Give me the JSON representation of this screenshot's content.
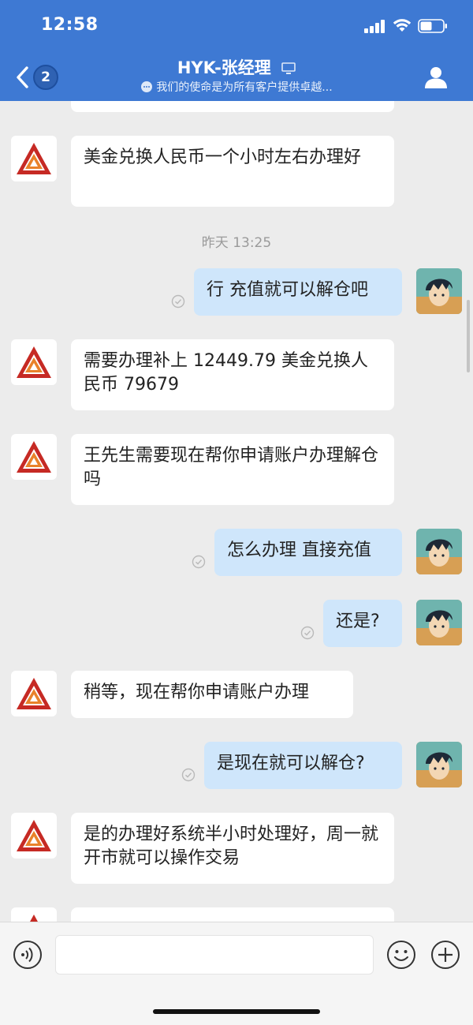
{
  "status_bar": {
    "time": "12:58"
  },
  "header": {
    "back_badge": "2",
    "title": "HYK-张经理",
    "subtitle": "我们的使命是为所有客户提供卓越..."
  },
  "messages": [
    {
      "side": "in",
      "text": "美金兑换人民币一个小时左右办理好"
    },
    {
      "type": "timestamp",
      "text": "昨天 13:25"
    },
    {
      "side": "out",
      "text": "行 充值就可以解仓吧"
    },
    {
      "side": "in",
      "text": "需要办理补上 12449.79 美金兑换人民币 79679"
    },
    {
      "side": "in",
      "text": "王先生需要现在帮你申请账户办理解仓吗"
    },
    {
      "side": "out",
      "text": "怎么办理 直接充值"
    },
    {
      "side": "out",
      "text": "还是?"
    },
    {
      "side": "in",
      "text": "稍等，现在帮你申请账户办理"
    },
    {
      "side": "out",
      "text": "是现在就可以解仓?"
    },
    {
      "side": "in",
      "text": "是的办理好系统半小时处理好，周一就开市就可以操作交易"
    }
  ],
  "colors": {
    "header": "#3e79d3",
    "incoming": "#ffffff",
    "outgoing": "#cfe6fb",
    "background": "#ececec"
  },
  "icons": [
    "back-chevron-icon",
    "monitor-icon",
    "chat-bubble-icon",
    "profile-icon",
    "voice-icon",
    "emoji-icon",
    "plus-icon",
    "read-check-icon",
    "company-logo-icon"
  ]
}
